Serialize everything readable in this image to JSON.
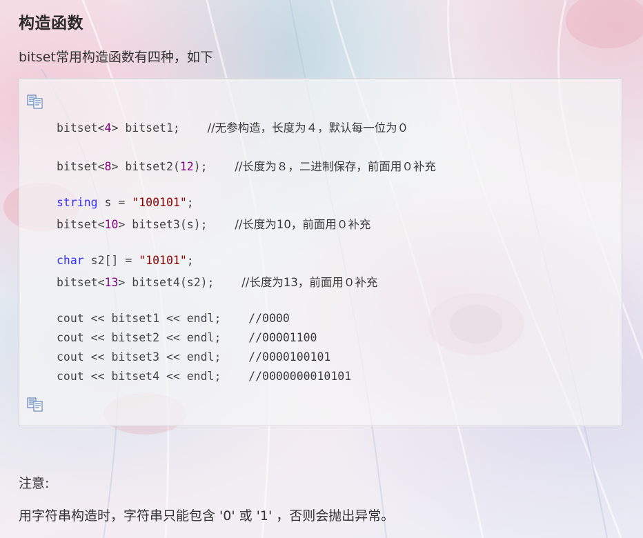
{
  "heading": "构造函数",
  "intro": "bitset常用构造函数有四种，如下",
  "code": {
    "line1": {
      "a": "bitset<",
      "n": "4",
      "b": "> bitset1;    ",
      "c": "//无参构造，长度为４，默认每一位为０"
    },
    "line2": {
      "a": "bitset<",
      "n": "8",
      "b": "> bitset2(",
      "n2": "12",
      "c1": ");    ",
      "c": "//长度为８，二进制保存，前面用０补充"
    },
    "line3": {
      "kw": "string",
      "a": " s = ",
      "s": "\"100101\"",
      "b": ";"
    },
    "line4": {
      "a": "bitset<",
      "n": "10",
      "b": "> bitset3(s);    ",
      "c": "//长度为10，前面用０补充"
    },
    "line5": {
      "kw": "char",
      "a": " s2[] = ",
      "s": "\"10101\"",
      "b": ";"
    },
    "line6": {
      "a": "bitset<",
      "n": "13",
      "b": "> bitset4(s2);    ",
      "c": "//长度为13，前面用０补充"
    },
    "line7": {
      "a": "cout << bitset1 << endl;    ",
      "c": "//0000"
    },
    "line8": {
      "a": "cout << bitset2 << endl;    ",
      "c": "//00001100"
    },
    "line9": {
      "a": "cout << bitset3 << endl;    ",
      "c": "//0000100101"
    },
    "line10": {
      "a": "cout << bitset4 << endl;    ",
      "c": "//0000000010101"
    }
  },
  "icons": {
    "copy": "copy-code-icon"
  },
  "note_label": "注意:",
  "note_text": "用字符串构造时，字符串只能包含 '0' 或 '1' ，否则会抛出异常。",
  "colors": {
    "keyword": "#3333ff",
    "number": "#800080",
    "string": "#8b0000"
  }
}
